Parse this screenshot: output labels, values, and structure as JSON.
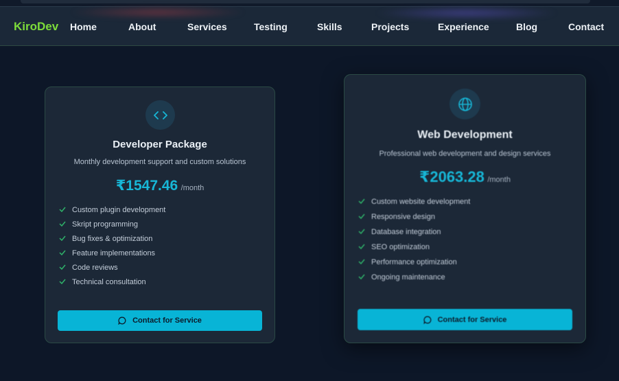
{
  "header": {
    "logo": "KiroDev",
    "nav": [
      "Home",
      "About",
      "Services",
      "Testing",
      "Skills",
      "Projects",
      "Experience",
      "Blog",
      "Contact"
    ]
  },
  "cards": [
    {
      "icon": "code-icon",
      "title": "Developer Package",
      "description": "Monthly development support and custom solutions",
      "price": "₹1547.46",
      "period": "/month",
      "features": [
        "Custom plugin development",
        "Skript programming",
        "Bug fixes & optimization",
        "Feature implementations",
        "Code reviews",
        "Technical consultation"
      ],
      "button": "Contact for Service"
    },
    {
      "icon": "globe-icon",
      "title": "Web Development",
      "description": "Professional web development and design services",
      "price": "₹2063.28",
      "period": "/month",
      "features": [
        "Custom website development",
        "Responsive design",
        "Database integration",
        "SEO optimization",
        "Performance optimization",
        "Ongoing maintenance"
      ],
      "button": "Contact for Service"
    }
  ],
  "colors": {
    "background": "#0d1728",
    "accent": "#08b4d6",
    "logo": "#7ddc3a",
    "check": "#2fb36a"
  }
}
